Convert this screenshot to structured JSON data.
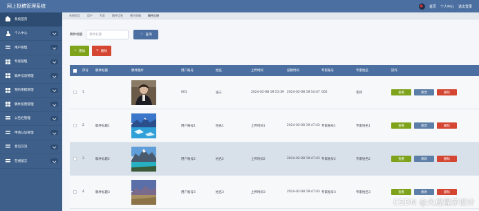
{
  "app": {
    "title": "网上投稿管理系统"
  },
  "header": {
    "links": [
      "首页",
      "个人中心",
      "退出登录"
    ]
  },
  "sidebar": {
    "items": [
      {
        "label": "系统首页",
        "icon": "home-icon"
      },
      {
        "label": "个人中心",
        "icon": "user-icon"
      },
      {
        "label": "用户管理",
        "icon": "menu-icon"
      },
      {
        "label": "专家管理",
        "icon": "grid-icon"
      },
      {
        "label": "稿件信息管理",
        "icon": "grid-icon"
      },
      {
        "label": "预约审稿管理",
        "icon": "grid-icon"
      },
      {
        "label": "稿件反馈管理",
        "icon": "grid-icon"
      },
      {
        "label": "公告栏管理",
        "icon": "menu-icon"
      },
      {
        "label": "申请认证管理",
        "icon": "menu-icon"
      },
      {
        "label": "意见交流",
        "icon": "menu-icon"
      },
      {
        "label": "在线留言",
        "icon": "menu-icon"
      }
    ]
  },
  "tabs": [
    "系统首页",
    "用户",
    "专家",
    "稿件信息",
    "预约审稿",
    "稿件反馈"
  ],
  "search": {
    "label": "稿件标题",
    "placeholder": "稿件标题",
    "button_label": "查询"
  },
  "actions": {
    "add_label": "添加",
    "delete_label": "删除"
  },
  "table": {
    "columns": [
      "",
      "序号",
      "稿件标题",
      "稿件图片",
      "用户账号",
      "姓名",
      "上传时间",
      "投稿时间",
      "专家账号",
      "专家姓名",
      "操作"
    ],
    "rows": [
      {
        "no": "1",
        "title": "",
        "account": "001",
        "name": "张三",
        "upload_time": "2024-02-08 19:53:39",
        "submit_time": "2024-02-08 19:54:47",
        "expert_account": "002",
        "expert_name": "李四"
      },
      {
        "no": "2",
        "title": "稿件标题1",
        "account": "用户账号1",
        "name": "姓名1",
        "upload_time": "上传时间1",
        "submit_time": "2024-02-08 19:47:43",
        "expert_account": "专家账号1",
        "expert_name": "专家姓名1"
      },
      {
        "no": "3",
        "title": "稿件标题2",
        "account": "用户账号2",
        "name": "姓名2",
        "upload_time": "上传时间2",
        "submit_time": "2024-02-08 19:47:43",
        "expert_account": "专家账号2",
        "expert_name": "专家姓名2"
      },
      {
        "no": "4",
        "title": "稿件标题3",
        "account": "用户账号3",
        "name": "姓名3",
        "upload_time": "上传时间3",
        "submit_time": "2024-02-08 19:47:43",
        "expert_account": "专家账号3",
        "expert_name": "专家姓名3"
      }
    ],
    "ops": {
      "view": "查看",
      "edit": "修改",
      "delete": "删除"
    }
  },
  "watermark": "CSDN @大成程序设计"
}
